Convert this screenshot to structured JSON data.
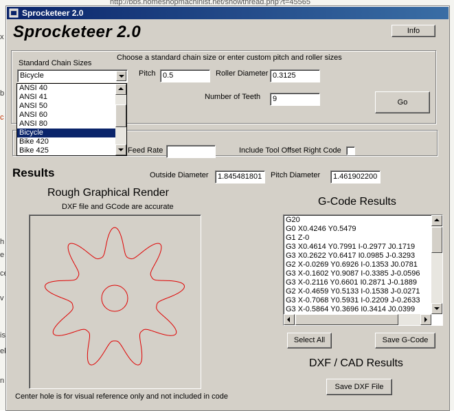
{
  "background": {
    "url_text": "http://bbs.homeshopmachinist.net/showthread.php?t=45565",
    "left_fragments": [
      "x",
      "b",
      "c",
      "h",
      "e",
      "ce",
      "v",
      "is",
      "ek",
      "n"
    ]
  },
  "window": {
    "title": "Sprocketeer 2.0",
    "app_name": "Sprocketeer 2.0",
    "info_button": "Info"
  },
  "chain": {
    "group_label": "Standard Chain Sizes",
    "instruction": "Choose a standard chain size or enter custom pitch and roller sizes",
    "selected": "Bicycle",
    "options": [
      "ANSI 40",
      "ANSI 41",
      "ANSI 50",
      "ANSI 60",
      "ANSI 80",
      "Bicycle",
      "Bike 420",
      "Bike 425"
    ],
    "pitch_label": "Pitch",
    "pitch_value": "0.5",
    "roller_label": "Roller Diameter",
    "roller_value": "0.3125",
    "teeth_label": "Number of Teeth",
    "teeth_value": "9",
    "go_button": "Go"
  },
  "cutting": {
    "feed_rate_label": "Feed Rate",
    "feed_rate_value": "",
    "tool_offset_label": "Include Tool Offset Right Code"
  },
  "results": {
    "heading": "Results",
    "outside_label": "Outside Diameter",
    "outside_value": "1.845481801",
    "pitch_diam_label": "Pitch Diameter",
    "pitch_diam_value": "1.461902200"
  },
  "render": {
    "heading": "Rough Graphical Render",
    "subtitle": "DXF file and GCode are accurate",
    "footnote": "Center hole is for visual reference only and not included in code",
    "tooth_count": 9,
    "stroke_color": "#e00000"
  },
  "gcode": {
    "heading": "G-Code Results",
    "lines": [
      "G20",
      "G0 X0.4246  Y0.5479",
      "G1 Z-0",
      "G3 X0.4614  Y0.7991 I-0.2977 J0.1719",
      "G3 X0.2622  Y0.6417 I0.0985 J-0.3293",
      "G2 X-0.0269  Y0.6926 I-0.1353 J0.0781",
      "G3 X-0.1602  Y0.9087 I-0.3385 J-0.0596",
      "G3 X-0.2116  Y0.6601 I0.2871 J-0.1889",
      "G2 X-0.4659  Y0.5133 I-0.1538 J-0.0271",
      "G3 X-0.7068  Y0.5931 I-0.2209 J-0.2633",
      "G3 X-0.5864  Y0.3696 I0.3414 J0.0399"
    ],
    "select_all_button": "Select All",
    "save_button": "Save G-Code"
  },
  "dxf": {
    "heading": "DXF / CAD Results",
    "save_button": "Save DXF File"
  }
}
